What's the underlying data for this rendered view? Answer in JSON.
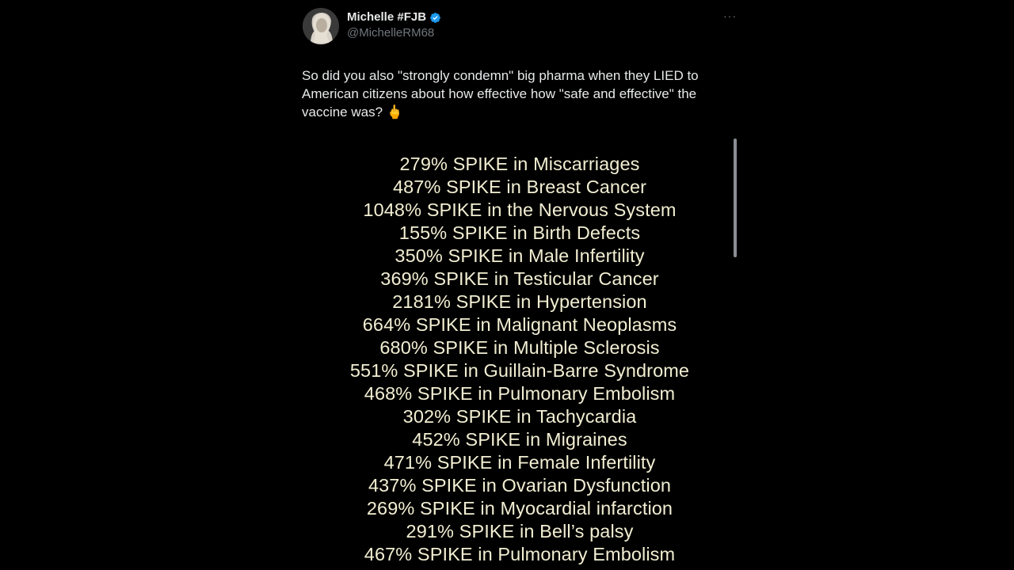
{
  "post": {
    "author": {
      "display_name": "Michelle #FJB",
      "handle": "@MichelleRM68",
      "verified": true
    },
    "more_icon": "more-horizontal-icon",
    "text": "So did you also \"strongly condemn\" big pharma when they LIED to American citizens about how effective how \"safe and effective\" the vaccine was? 🖕",
    "media_lines": [
      "279% SPIKE in Miscarriages",
      "487% SPIKE in Breast Cancer",
      "1048% SPIKE in the Nervous System",
      "155% SPIKE in Birth Defects",
      "350% SPIKE in Male Infertility",
      "369% SPIKE in Testicular Cancer",
      "2181% SPIKE in Hypertension",
      "664% SPIKE in Malignant Neoplasms",
      "680% SPIKE in Multiple Sclerosis",
      "551% SPIKE in Guillain-Barre Syndrome",
      "468% SPIKE in Pulmonary Embolism",
      "302% SPIKE in Tachycardia",
      "452% SPIKE in Migraines",
      "471% SPIKE in Female Infertility",
      "437% SPIKE in Ovarian Dysfunction",
      "269% SPIKE in Myocardial infarction",
      "291% SPIKE in Bell’s palsy",
      "467% SPIKE in Pulmonary Embolism"
    ]
  },
  "colors": {
    "background": "#000000",
    "text_primary": "#e7e9ea",
    "text_secondary": "#71767b",
    "verified": "#1d9bf0",
    "media_text": "#f2eed2"
  }
}
